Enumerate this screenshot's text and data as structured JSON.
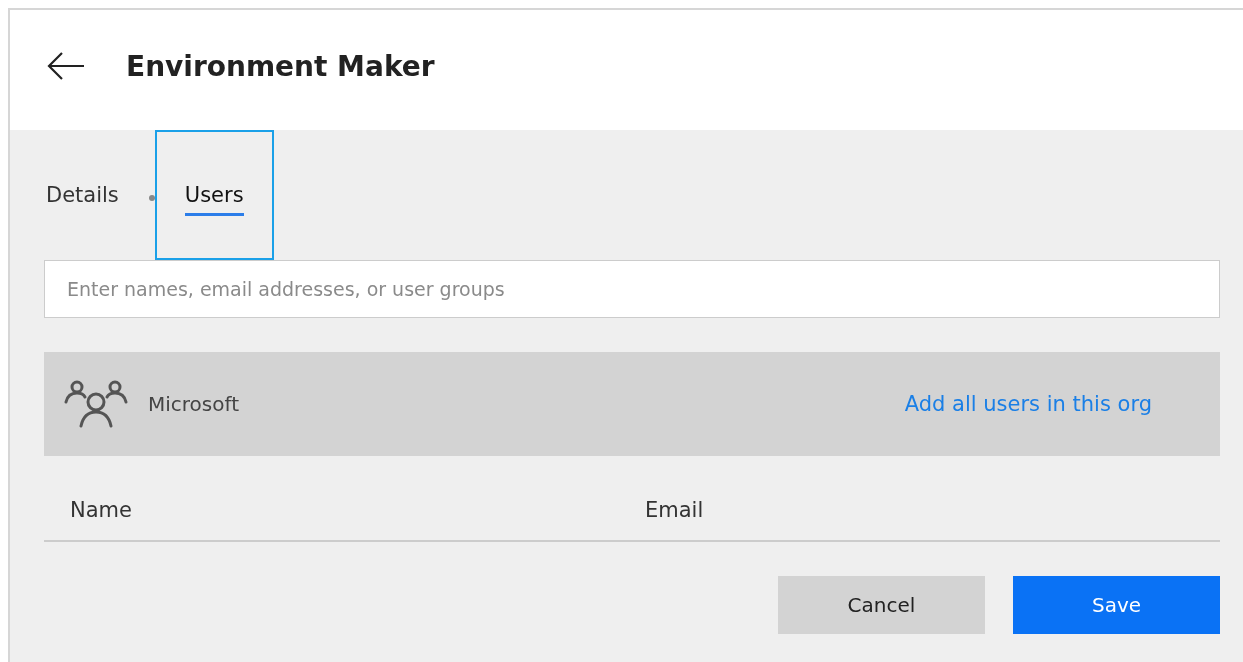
{
  "header": {
    "title": "Environment Maker"
  },
  "tabs": [
    {
      "label": "Details",
      "selected": false,
      "focused": false
    },
    {
      "label": "Users",
      "selected": true,
      "focused": true
    }
  ],
  "search": {
    "placeholder": "Enter names, email addresses, or user groups"
  },
  "org": {
    "name": "Microsoft",
    "action": "Add all users in this org"
  },
  "table": {
    "columns": [
      "Name",
      "Email"
    ]
  },
  "buttons": [
    {
      "label": "Cancel",
      "kind": "secondary"
    },
    {
      "label": "Save",
      "kind": "primary"
    }
  ]
}
